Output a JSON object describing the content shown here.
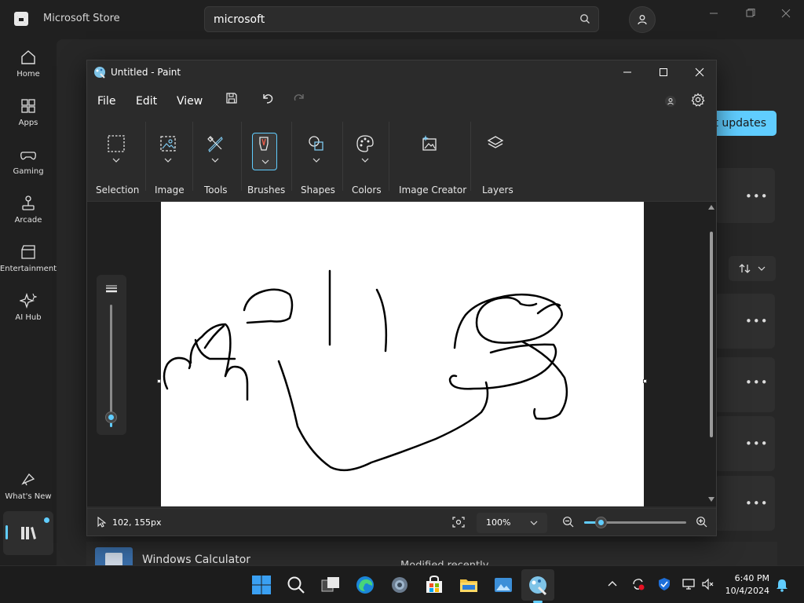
{
  "store": {
    "title": "Microsoft Store",
    "search_value": "microsoft",
    "nav": [
      {
        "label": "Home"
      },
      {
        "label": "Apps"
      },
      {
        "label": "Gaming"
      },
      {
        "label": "Arcade"
      },
      {
        "label": "Entertainment"
      },
      {
        "label": "AI Hub"
      },
      {
        "label": "What's New"
      }
    ],
    "get_updates_label": "Get updates",
    "more_label": "•••",
    "calc_name": "Windows Calculator",
    "calc_meta": "Modified recently"
  },
  "paint": {
    "title": "Untitled - Paint",
    "menu": {
      "file": "File",
      "edit": "Edit",
      "view": "View"
    },
    "ribbon": {
      "selection": "Selection",
      "image": "Image",
      "tools": "Tools",
      "brushes": "Brushes",
      "shapes": "Shapes",
      "colors": "Colors",
      "image_creator": "Image Creator",
      "layers": "Layers"
    },
    "status": {
      "coords": "102, 155px",
      "zoom": "100%",
      "zoom_slider_fraction": 0.17
    }
  },
  "taskbar": {
    "time": "6:40 PM",
    "date": "10/4/2024"
  },
  "colors": {
    "accent": "#60cdff",
    "app_bg": "#202020",
    "canvas": "#ffffff"
  }
}
